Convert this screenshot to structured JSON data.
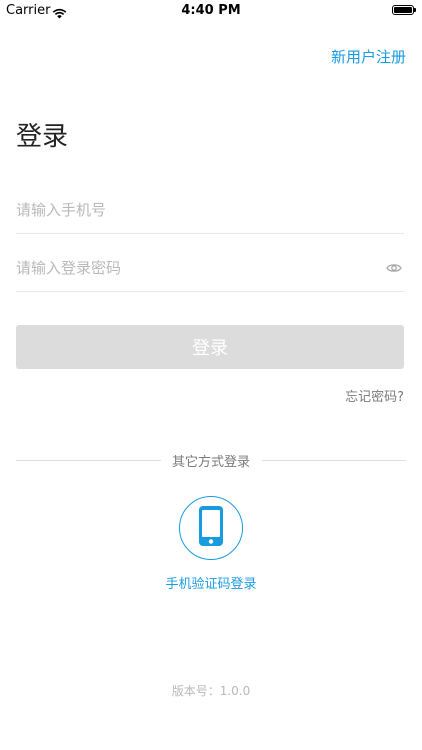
{
  "status_bar": {
    "carrier": "Carrier",
    "time": "4:40 PM",
    "battery_level": 1.0
  },
  "header": {
    "register_label": "新用户注册"
  },
  "main": {
    "title": "登录",
    "phone_input": {
      "placeholder": "请输入手机号",
      "value": ""
    },
    "password_input": {
      "placeholder": "请输入登录密码",
      "value": ""
    },
    "login_button_label": "登录",
    "forgot_label": "忘记密码?"
  },
  "other_methods": {
    "divider_label": "其它方式登录",
    "sms_login_label": "手机验证码登录"
  },
  "footer": {
    "version_label": "版本号：1.0.0"
  },
  "icons": {
    "wifi": "wifi-icon",
    "battery": "battery-icon",
    "eye": "eye-icon",
    "phone": "smartphone-icon"
  },
  "colors": {
    "accent": "#1a9be0",
    "button_disabled": "#dcdcdc",
    "placeholder": "#b9b9b9",
    "secondary_text": "#7a7a7a"
  }
}
